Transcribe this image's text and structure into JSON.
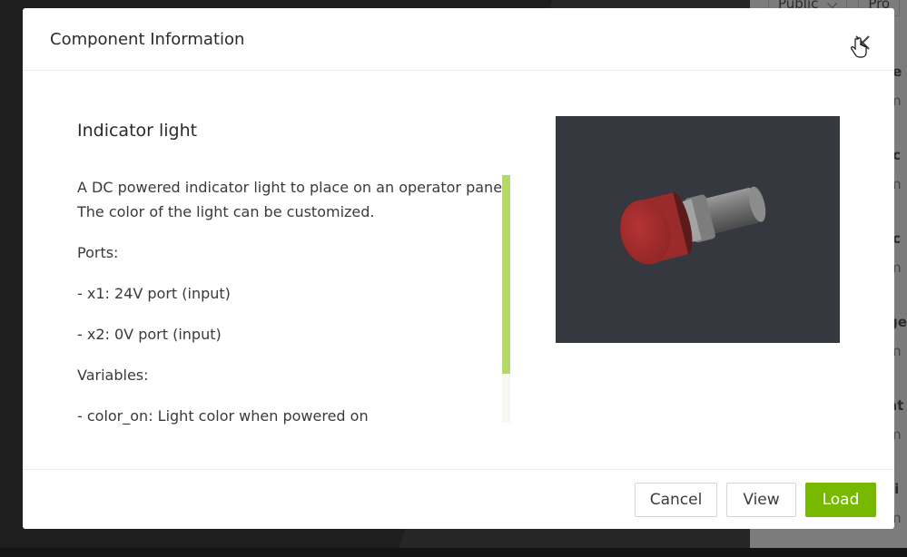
{
  "background": {
    "dropdowns": [
      "Public",
      "Pro"
    ],
    "list_items": [
      {
        "title": "le",
        "subtitle": "m"
      },
      {
        "title": "ic",
        "subtitle": "m"
      },
      {
        "title": "ic",
        "subtitle": "m"
      },
      {
        "title": "ge",
        "subtitle": "m"
      },
      {
        "title": "at",
        "subtitle": "m"
      },
      {
        "title": "ti",
        "subtitle": "m"
      }
    ]
  },
  "modal": {
    "title": "Component Information",
    "component_name": "Indicator light",
    "description": [
      "A DC powered indicator light to place on an operator panel.",
      "The color of the light can be customized.",
      "Ports:",
      "- x1: 24V port (input)",
      "- x2: 0V port (input)",
      "Variables:",
      "- color_on: Light color when powered on"
    ],
    "preview_icon": "indicator-light-3d-model",
    "buttons": {
      "cancel": "Cancel",
      "view": "View",
      "load": "Load"
    },
    "colors": {
      "accent": "#76b900",
      "scrollbar_thumb": "#b5db62",
      "preview_bg": "#363840"
    }
  }
}
